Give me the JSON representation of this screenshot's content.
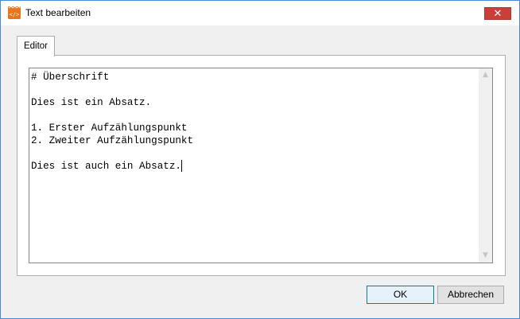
{
  "window": {
    "title": "Text bearbeiten",
    "icon": "code-file-icon",
    "accent_color": "#e8741c",
    "close_symbol": "✕"
  },
  "tabs": [
    {
      "label": "Editor",
      "selected": true
    }
  ],
  "editor": {
    "lines": [
      "# Überschrift",
      "",
      "Dies ist ein Absatz.",
      "",
      "1. Erster Aufzählungspunkt",
      "2. Zweiter Aufzählungspunkt",
      "",
      "Dies ist auch ein Absatz."
    ],
    "scroll_up_symbol": "▲",
    "scroll_down_symbol": "▼"
  },
  "buttons": {
    "ok_label": "OK",
    "cancel_label": "Abbrechen"
  }
}
